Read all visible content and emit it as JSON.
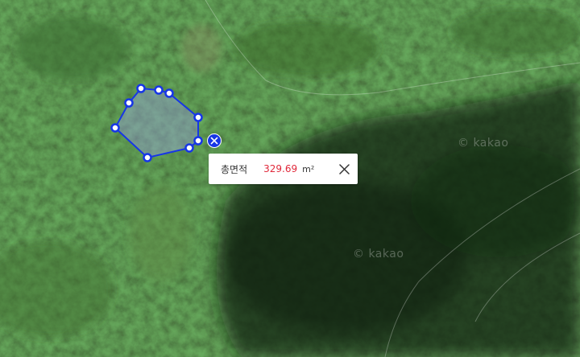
{
  "map": {
    "provider_watermark": "© kakao",
    "polygon_color": "#1736e6"
  },
  "measure_popup": {
    "label": "총면적",
    "value": "329.69",
    "unit": "m²",
    "value_color": "#e0283a"
  },
  "icons": {
    "close_drawing": "close-icon",
    "close_popup": "close-icon"
  }
}
